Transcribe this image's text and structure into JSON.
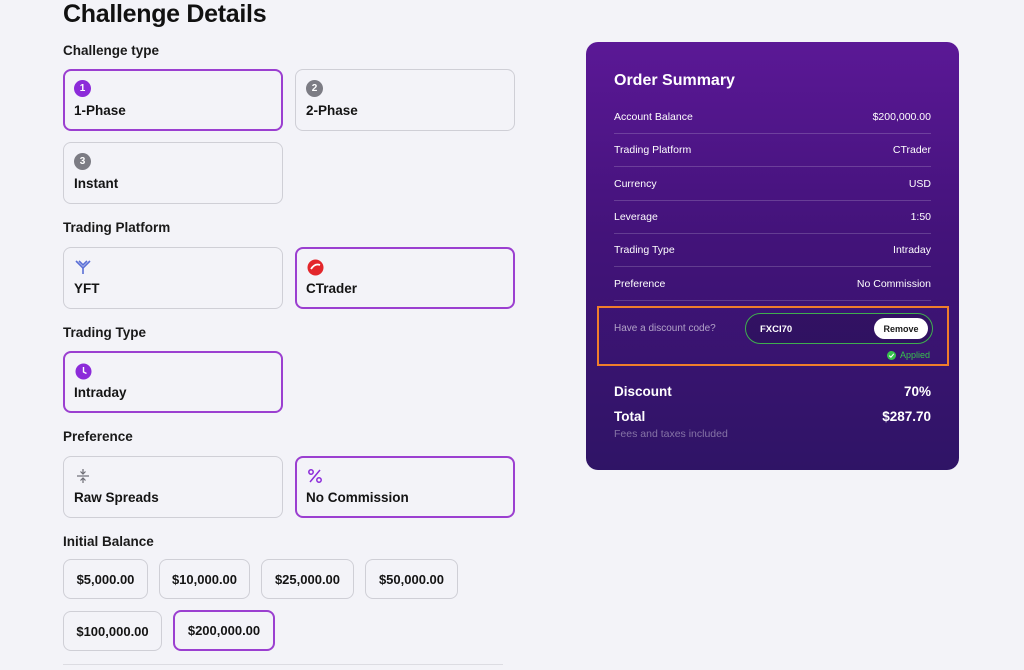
{
  "page": {
    "title": "Challenge Details"
  },
  "challenge_type": {
    "label": "Challenge type",
    "options": [
      {
        "badge": "1",
        "label": "1-Phase",
        "selected": true
      },
      {
        "badge": "2",
        "label": "2-Phase",
        "selected": false
      },
      {
        "badge": "3",
        "label": "Instant",
        "selected": false
      }
    ]
  },
  "trading_platform": {
    "label": "Trading Platform",
    "options": [
      {
        "icon": "yft-logo-icon",
        "label": "YFT",
        "selected": false
      },
      {
        "icon": "ctrader-logo-icon",
        "label": "CTrader",
        "selected": true
      }
    ]
  },
  "trading_type": {
    "label": "Trading Type",
    "options": [
      {
        "icon": "clock-icon",
        "label": "Intraday",
        "selected": true
      }
    ]
  },
  "preference": {
    "label": "Preference",
    "options": [
      {
        "icon": "compress-arrows-icon",
        "label": "Raw Spreads",
        "selected": false
      },
      {
        "icon": "percent-icon",
        "label": "No Commission",
        "selected": true
      }
    ]
  },
  "initial_balance": {
    "label": "Initial Balance",
    "options": [
      {
        "label": "$5,000.00",
        "selected": false
      },
      {
        "label": "$10,000.00",
        "selected": false
      },
      {
        "label": "$25,000.00",
        "selected": false
      },
      {
        "label": "$50,000.00",
        "selected": false
      },
      {
        "label": "$100,000.00",
        "selected": false
      },
      {
        "label": "$200,000.00",
        "selected": true
      }
    ]
  },
  "order_summary": {
    "title": "Order Summary",
    "rows": [
      {
        "key": "Account Balance",
        "value": "$200,000.00"
      },
      {
        "key": "Trading Platform",
        "value": "CTrader"
      },
      {
        "key": "Currency",
        "value": "USD"
      },
      {
        "key": "Leverage",
        "value": "1:50"
      },
      {
        "key": "Trading Type",
        "value": "Intraday"
      },
      {
        "key": "Preference",
        "value": "No Commission"
      }
    ],
    "discount_prompt": "Have a discount code?",
    "discount_code": "FXCI70",
    "remove_label": "Remove",
    "applied_label": "Applied",
    "discount_label": "Discount",
    "discount_value": "70%",
    "total_label": "Total",
    "total_value": "$287.70",
    "fees_note": "Fees and taxes included"
  },
  "colors": {
    "accent": "#8c2bd9",
    "selected_border": "#9b3fd0",
    "applied_green": "#37c24d",
    "highlight_orange": "#f07e2b"
  }
}
